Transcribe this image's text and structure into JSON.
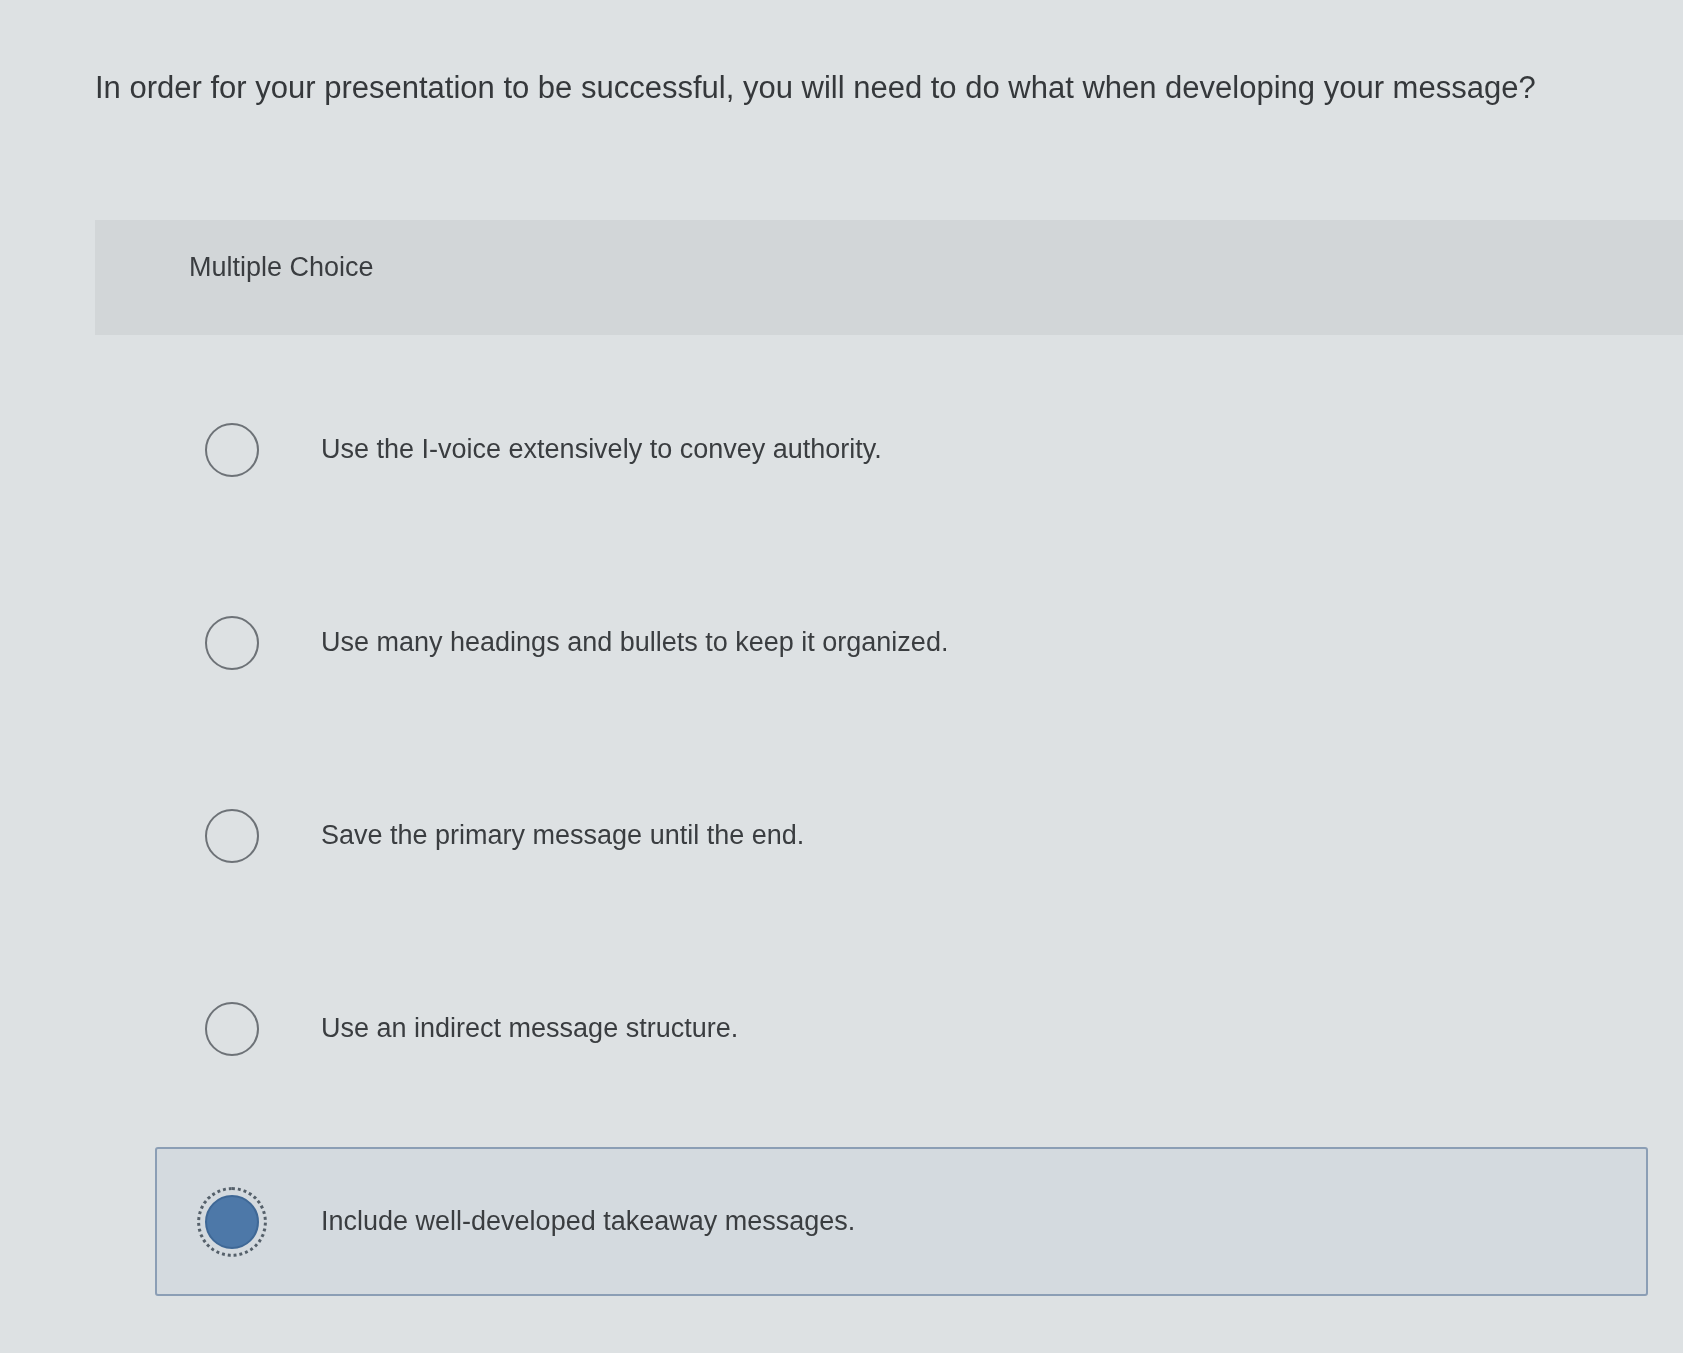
{
  "question": "In order for your presentation to be successful, you will need to do what when developing your message?",
  "question_type": "Multiple Choice",
  "options": [
    {
      "label": "Use the I-voice extensively to convey authority.",
      "selected": false
    },
    {
      "label": "Use many headings and bullets to keep it organized.",
      "selected": false
    },
    {
      "label": "Save the primary message until the end.",
      "selected": false
    },
    {
      "label": "Use an indirect message structure.",
      "selected": false
    },
    {
      "label": "Include well-developed takeaway messages.",
      "selected": true
    }
  ]
}
